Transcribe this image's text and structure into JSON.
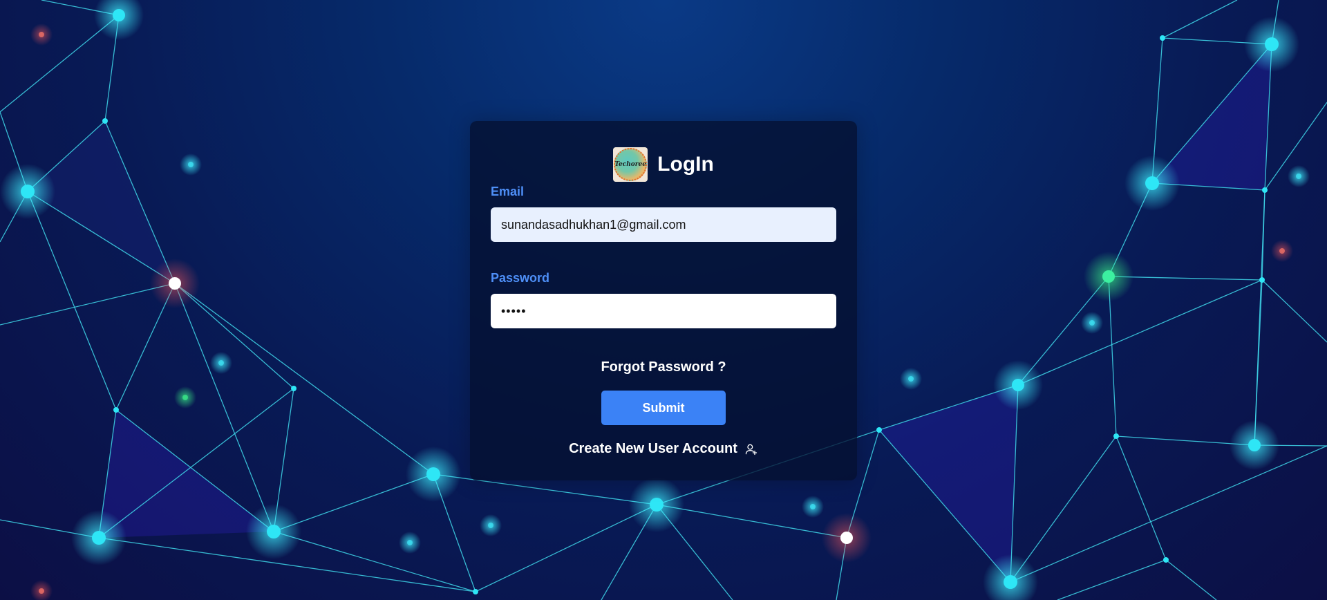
{
  "login": {
    "title": "LogIn",
    "logo_text": "Techoree",
    "email_label": "Email",
    "email_value": "sunandasadhukhan1@gmail.com",
    "password_label": "Password",
    "password_value": "•••••",
    "forgot_label": "Forgot Password ?",
    "submit_label": "Submit",
    "create_label": "Create New User Account"
  },
  "colors": {
    "accent": "#3b82f6",
    "label": "#4e8ff7",
    "node": "#2ee6f6",
    "line": "#3fd8ea"
  },
  "icons": {
    "create": "add-user-icon"
  }
}
